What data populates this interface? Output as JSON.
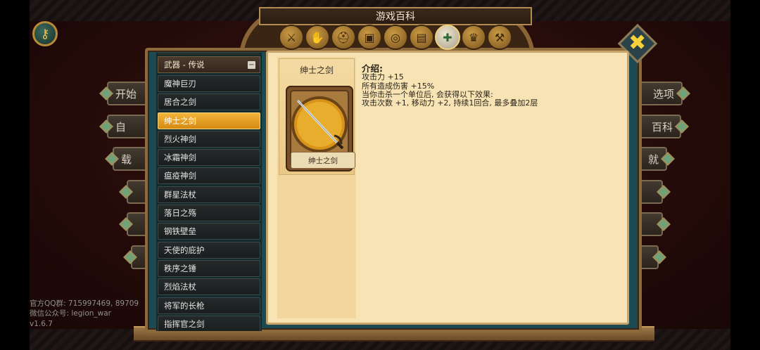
{
  "header": {
    "title": "游戏百科"
  },
  "menu": {
    "left": [
      "开始",
      "自",
      "载",
      "",
      "",
      ""
    ],
    "right": [
      "选项",
      "百科",
      "就",
      "",
      "",
      ""
    ]
  },
  "info_lines": [
    "官方QQ群: 715997469, 89709",
    "微信公众号: legion_war",
    "v1.6.7"
  ],
  "category_icons": [
    "sword-category-icon",
    "claw-category-icon",
    "helmet-category-icon",
    "armor-category-icon",
    "spiral-category-icon",
    "book-category-icon",
    "sword-emblem-category-icon",
    "cape-category-icon",
    "hammer-category-icon"
  ],
  "active_category_index": 6,
  "list": {
    "header": "武器 - 传说",
    "items": [
      "魔神巨刃",
      "居合之剑",
      "绅士之剑",
      "烈火神剑",
      "冰霜神剑",
      "瘟疫神剑",
      "群星法杖",
      "落日之殇",
      "钢铁壁垒",
      "天使的庇护",
      "秩序之锤",
      "烈焰法杖",
      "将军的长枪",
      "指挥官之剑"
    ],
    "selected_index": 2
  },
  "detail": {
    "name": "绅士之剑",
    "plate_label": "绅士之剑",
    "intro_label": "介绍:",
    "lines": [
      "攻击力 +15",
      "所有造成伤害 +15%",
      "当你击杀一个单位后, 会获得以下效果:",
      "攻击次数 +1, 移动力 +2, 持续1回合, 最多叠加2层"
    ]
  },
  "close_label": "✖"
}
